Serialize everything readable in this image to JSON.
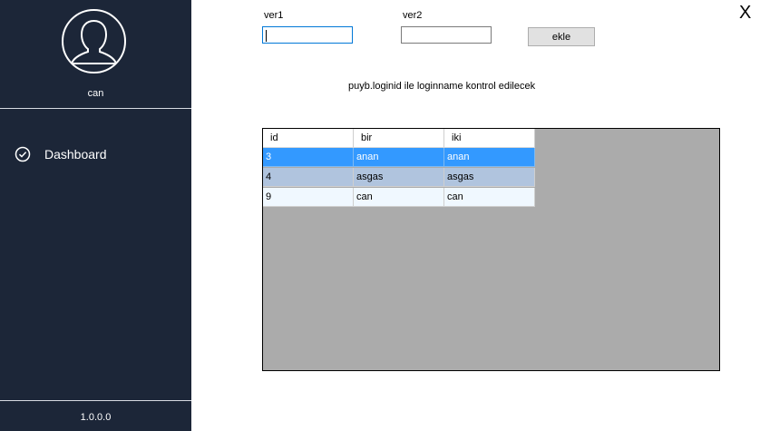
{
  "sidebar": {
    "username": "can",
    "nav": [
      {
        "label": "Dashboard",
        "icon": "check-circle-icon"
      }
    ],
    "version": "1.0.0.0"
  },
  "form": {
    "ver1_label": "ver1",
    "ver1_value": "",
    "ver2_label": "ver2",
    "ver2_value": "",
    "add_button": "ekle",
    "note": "puyb.loginid ile loginname kontrol edilecek"
  },
  "window": {
    "close_label": "X"
  },
  "grid": {
    "columns": [
      "id",
      "bir",
      "iki"
    ],
    "rows": [
      {
        "id": "3",
        "bir": "anan",
        "iki": "anan",
        "selected": true
      },
      {
        "id": "4",
        "bir": "asgas",
        "iki": "asgas"
      },
      {
        "id": "9",
        "bir": "can",
        "iki": "can"
      }
    ]
  },
  "colors": {
    "sidebar_bg": "#1c2638",
    "selection": "#3399ff",
    "alt_row": "#b0c4de",
    "row": "#f0f8ff",
    "grid_bg": "#ababab"
  }
}
